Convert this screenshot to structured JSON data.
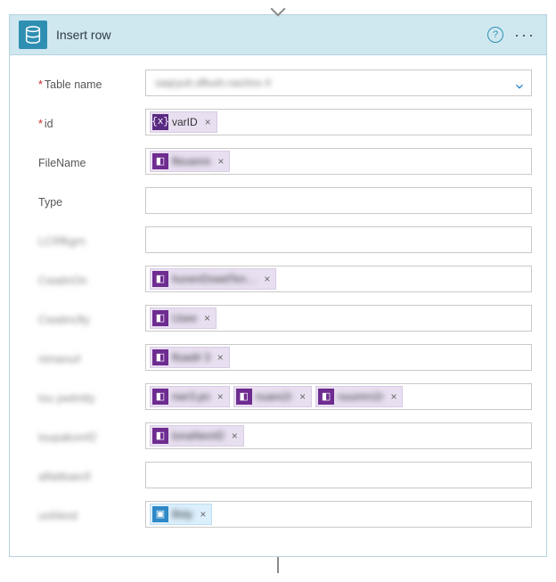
{
  "header": {
    "title": "Insert row",
    "help_glyph": "?",
    "menu_glyph": "···"
  },
  "rows": [
    {
      "label": "Table name",
      "required": true,
      "blurred_label": false,
      "dropdown": true,
      "placeholder_text": "saqryuh.dflush.nachnx #",
      "tokens": []
    },
    {
      "label": "id",
      "required": true,
      "blurred_label": false,
      "tokens": [
        {
          "label": "varID",
          "kind": "fx",
          "glyph": "{x}",
          "blurred": false
        }
      ]
    },
    {
      "label": "FileName",
      "required": false,
      "blurred_label": false,
      "tokens": [
        {
          "label": "fleuanre",
          "kind": "purple",
          "glyph": "◧",
          "blurred": true
        }
      ]
    },
    {
      "label": "Type",
      "required": false,
      "blurred_label": false,
      "tokens": []
    },
    {
      "label": "LCRfkgrn",
      "required": false,
      "blurred_label": true,
      "tokens": []
    },
    {
      "label": "CwatinOn",
      "required": false,
      "blurred_label": true,
      "tokens": [
        {
          "label": "hunenDowdTen…",
          "kind": "purple",
          "glyph": "◧",
          "blurred": true
        }
      ]
    },
    {
      "label": "Cwatincfty",
      "required": false,
      "blurred_label": true,
      "tokens": [
        {
          "label": "Usee",
          "kind": "purple",
          "glyph": "◧",
          "blurred": true
        }
      ]
    },
    {
      "label": "nimanu#",
      "required": false,
      "blurred_label": true,
      "tokens": [
        {
          "label": "fload# 3",
          "kind": "purple",
          "glyph": "◧",
          "blurred": true
        }
      ]
    },
    {
      "label": "tou pwtmtty",
      "required": false,
      "blurred_label": true,
      "tokens": [
        {
          "label": "nwr3.pn",
          "kind": "purple",
          "glyph": "◧",
          "blurred": true
        },
        {
          "label": "nuare2r",
          "kind": "purple",
          "glyph": "◧",
          "blurred": true
        },
        {
          "label": "nuumrn2r",
          "kind": "purple",
          "glyph": "◧",
          "blurred": true
        }
      ]
    },
    {
      "label": "toupakomf2",
      "required": false,
      "blurred_label": true,
      "tokens": [
        {
          "label": "tonaNemf2",
          "kind": "purple",
          "glyph": "◧",
          "blurred": true
        }
      ]
    },
    {
      "label": "alfaitkaecll",
      "required": false,
      "blurred_label": true,
      "tokens": []
    },
    {
      "label": "unihknd",
      "required": false,
      "blurred_label": true,
      "tokens": [
        {
          "label": "Bidy",
          "kind": "blue",
          "glyph": "▣",
          "blurred": true
        }
      ]
    }
  ]
}
